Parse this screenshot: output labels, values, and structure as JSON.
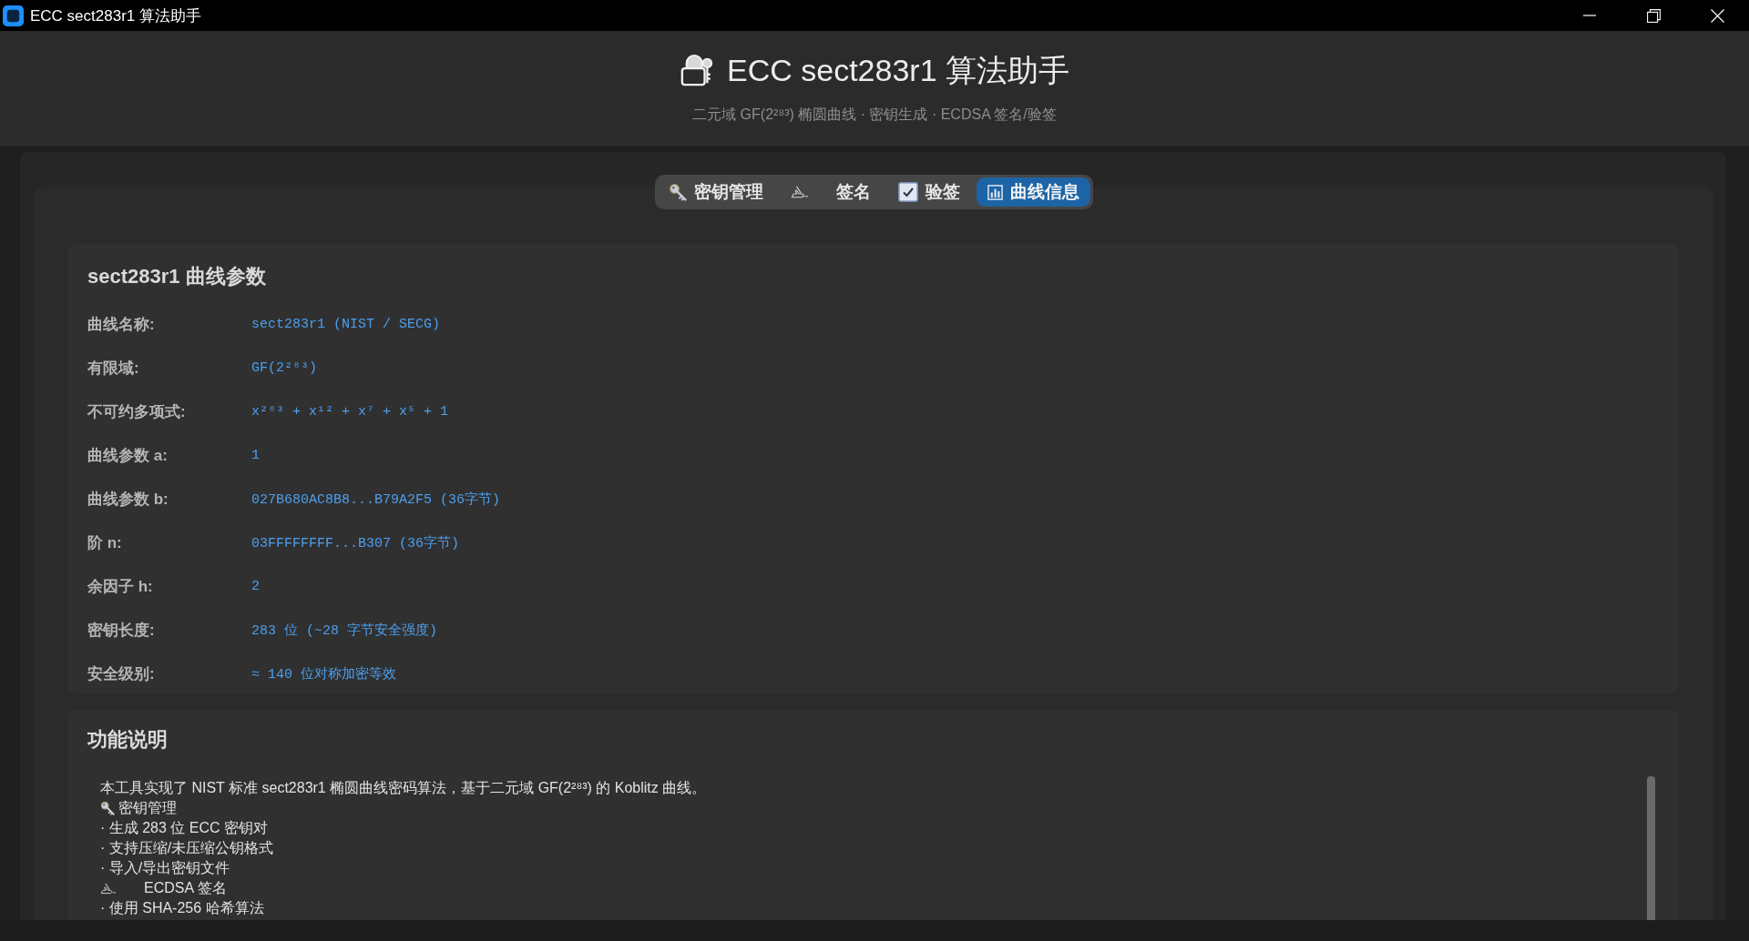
{
  "window": {
    "title": "ECC sect283r1 算法助手"
  },
  "header": {
    "title": "ECC sect283r1 算法助手",
    "subtitle": "二元域 GF(2²⁸³) 椭圆曲线 · 密钥生成 · ECDSA 签名/验签"
  },
  "tabs": [
    {
      "label": "密钥管理",
      "selected": false
    },
    {
      "label": "签名",
      "selected": false
    },
    {
      "label": "验签",
      "selected": false
    },
    {
      "label": "曲线信息",
      "selected": true
    }
  ],
  "curve_params": {
    "title": "sect283r1 曲线参数",
    "rows": [
      {
        "label": "曲线名称:",
        "value": "sect283r1 (NIST / SECG)"
      },
      {
        "label": "有限域:",
        "value": "GF(2²⁸³)"
      },
      {
        "label": "不可约多项式:",
        "value": "x²⁸³ + x¹² + x⁷ + x⁵ + 1"
      },
      {
        "label": "曲线参数 a:",
        "value": "1"
      },
      {
        "label": "曲线参数 b:",
        "value": "027B680AC8B8...B79A2F5 (36字节)"
      },
      {
        "label": "阶 n:",
        "value": "03FFFFFFFF...B307 (36字节)"
      },
      {
        "label": "余因子 h:",
        "value": "2"
      },
      {
        "label": "密钥长度:",
        "value": "283 位 (~28 字节安全强度)"
      },
      {
        "label": "安全级别:",
        "value": "≈ 140 位对称加密等效"
      }
    ]
  },
  "description": {
    "title": "功能说明",
    "lines": [
      {
        "kind": "text",
        "text": "本工具实现了 NIST 标准 sect283r1 椭圆曲线密码算法，基于二元域 GF(2²⁸³) 的 Koblitz 曲线。"
      },
      {
        "kind": "section",
        "text": "密钥管理"
      },
      {
        "kind": "text",
        "text": "· 生成 283 位 ECC 密钥对"
      },
      {
        "kind": "text",
        "text": "· 支持压缩/未压缩公钥格式"
      },
      {
        "kind": "text",
        "text": "· 导入/导出密钥文件"
      },
      {
        "kind": "section",
        "text": "ECDSA 签名"
      },
      {
        "kind": "text",
        "text": "· 使用 SHA-256 哈希算法"
      }
    ]
  }
}
